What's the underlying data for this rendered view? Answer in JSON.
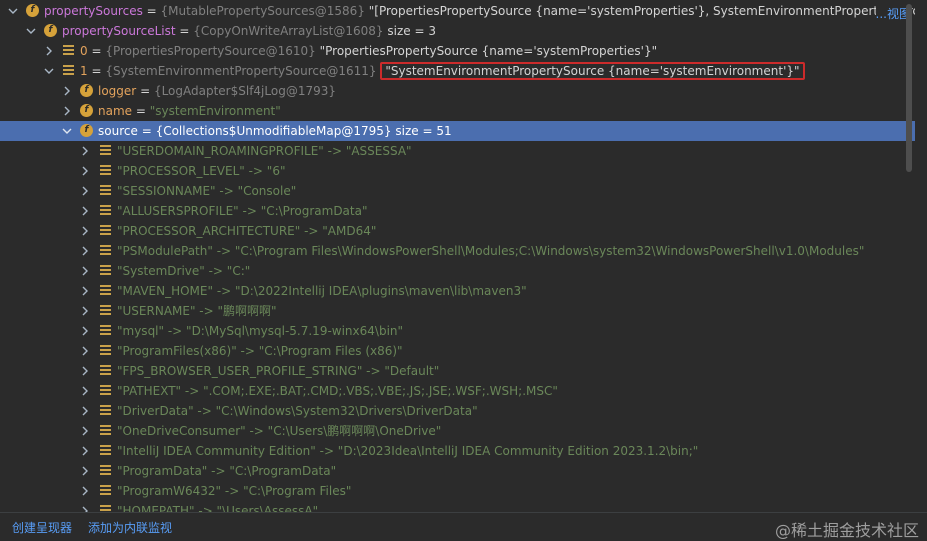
{
  "tree": {
    "root": {
      "name": "propertySources",
      "ref": "{MutablePropertySources@1586}",
      "value": "\"[PropertiesPropertySource {name='systemProperties'}, SystemEnvironmentPropertySource {",
      "more": "...视图"
    },
    "list": {
      "name": "propertySourceList",
      "ref": "{CopyOnWriteArrayList@1608}",
      "size": "size = 3"
    },
    "item0": {
      "name": "0",
      "ref": "{PropertiesPropertySource@1610}",
      "value": "\"PropertiesPropertySource {name='systemProperties'}\""
    },
    "item1": {
      "name": "1",
      "ref": "{SystemEnvironmentPropertySource@1611}",
      "value": "\"SystemEnvironmentPropertySource {name='systemEnvironment'}\""
    },
    "logger": {
      "name": "logger",
      "ref": "{LogAdapter$Slf4jLog@1793}"
    },
    "nameField": {
      "name": "name",
      "value": "\"systemEnvironment\""
    },
    "source": {
      "name": "source",
      "ref": "{Collections$UnmodifiableMap@1795}",
      "size": "size = 51"
    },
    "entries": [
      "\"USERDOMAIN_ROAMINGPROFILE\" -> \"ASSESSA\"",
      "\"PROCESSOR_LEVEL\" -> \"6\"",
      "\"SESSIONNAME\" -> \"Console\"",
      "\"ALLUSERSPROFILE\" -> \"C:\\ProgramData\"",
      "\"PROCESSOR_ARCHITECTURE\" -> \"AMD64\"",
      "\"PSModulePath\" -> \"C:\\Program Files\\WindowsPowerShell\\Modules;C:\\Windows\\system32\\WindowsPowerShell\\v1.0\\Modules\"",
      "\"SystemDrive\" -> \"C:\"",
      "\"MAVEN_HOME\" -> \"D:\\2022Intellij IDEA\\plugins\\maven\\lib\\maven3\"",
      "\"USERNAME\" -> \"鹏啊啊啊\"",
      "\"mysql\" -> \"D:\\MySql\\mysql-5.7.19-winx64\\bin\"",
      "\"ProgramFiles(x86)\" -> \"C:\\Program Files (x86)\"",
      "\"FPS_BROWSER_USER_PROFILE_STRING\" -> \"Default\"",
      "\"PATHEXT\" -> \".COM;.EXE;.BAT;.CMD;.VBS;.VBE;.JS;.JSE;.WSF;.WSH;.MSC\"",
      "\"DriverData\" -> \"C:\\Windows\\System32\\Drivers\\DriverData\"",
      "\"OneDriveConsumer\" -> \"C:\\Users\\鹏啊啊啊\\OneDrive\"",
      "\"IntelliJ IDEA Community Edition\" -> \"D:\\2023Idea\\IntelliJ IDEA Community Edition 2023.1.2\\bin;\"",
      "\"ProgramData\" -> \"C:\\ProgramData\"",
      "\"ProgramW6432\" -> \"C:\\Program Files\"",
      "\"HOMEPATH\" -> \"\\Users\\AssessA\""
    ]
  },
  "bottombar": {
    "create_renderer": "创建呈现器",
    "add_inline_watch": "添加为内联监视",
    "watermark": "@稀土掘金技术社区"
  },
  "colors": {
    "selected": "#4b6eaf",
    "highlight_border": "#cc2b2b",
    "link": "#589df6"
  }
}
